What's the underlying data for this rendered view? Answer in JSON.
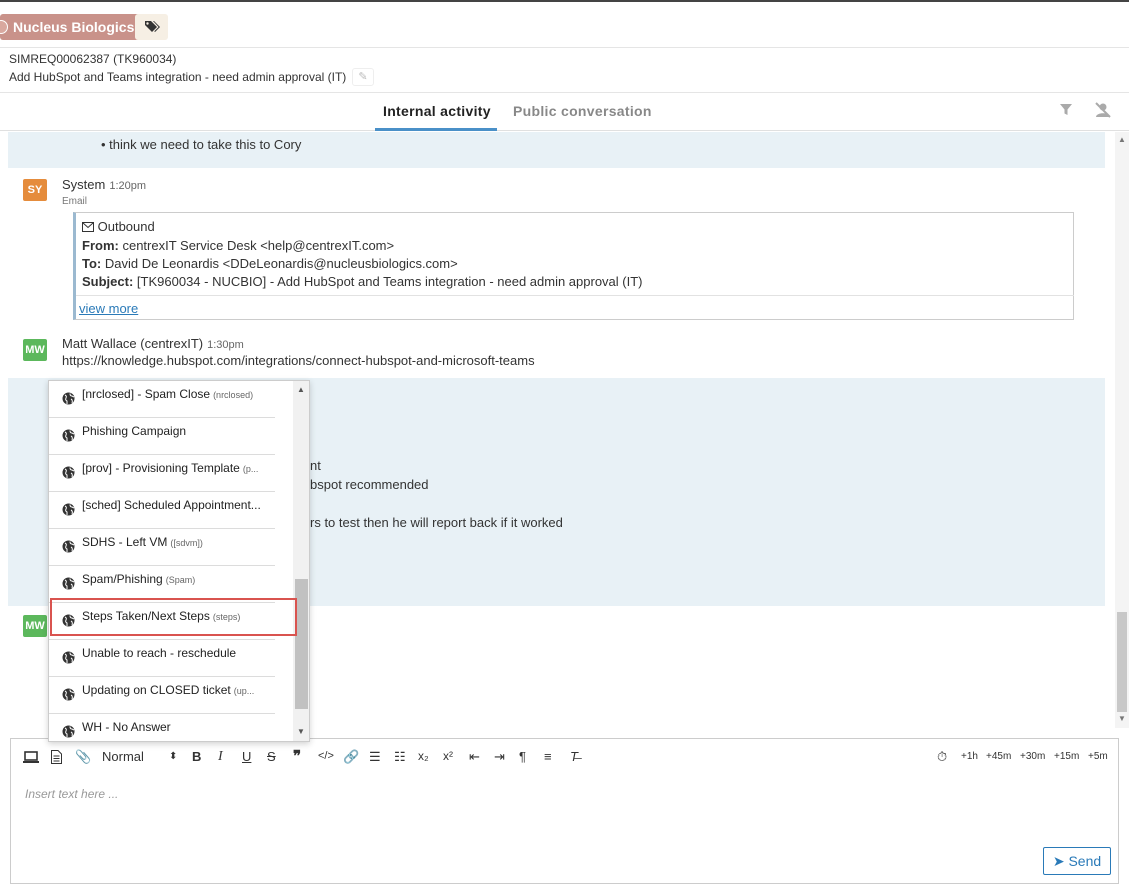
{
  "header": {
    "org_name": "Nucleus Biologics",
    "ticket_id": "SIMREQ00062387 (TK960034)",
    "ticket_title": "Add HubSpot and Teams integration - need admin approval (IT)"
  },
  "tabs": [
    {
      "label": "Internal activity",
      "active": true
    },
    {
      "label": "Public conversation",
      "active": false
    }
  ],
  "feed": {
    "bullet_line": "• think we need to take this to Cory",
    "entries": [
      {
        "initials": "SY",
        "author": "System",
        "time": "1:20pm",
        "sub": "Email",
        "email": {
          "direction": "Outbound",
          "from_label": "From:",
          "from": "centrexIT Service Desk <help@centrexIT.com>",
          "to_label": "To:",
          "to": "David De Leonardis <DDeLeonardis@nucleusbiologics.com>",
          "subject_label": "Subject:",
          "subject": "[TK960034 - NUCBIO] - Add HubSpot and Teams integration - need admin approval (IT)",
          "view_more": "view more"
        }
      },
      {
        "initials": "MW",
        "author": "Matt Wallace (centrexIT)",
        "time": "1:30pm",
        "text": "https://knowledge.hubspot.com/integrations/connect-hubspot-and-microsoft-teams"
      }
    ],
    "partial_lines": [
      "nt",
      "bspot recommended",
      "rs to test then he will report back if it worked"
    ],
    "third_initials": "MW"
  },
  "dropdown": {
    "items": [
      {
        "label": "[nrclosed] - Spam Close",
        "shortcut": "(nrclosed)"
      },
      {
        "label": "Phishing Campaign",
        "shortcut": ""
      },
      {
        "label": "[prov] - Provisioning Template",
        "shortcut": "(p..."
      },
      {
        "label": "[sched] Scheduled Appointment...",
        "shortcut": ""
      },
      {
        "label": "SDHS - Left VM",
        "shortcut": "([sdvm])"
      },
      {
        "label": "Spam/Phishing",
        "shortcut": "(Spam)"
      },
      {
        "label": "Steps Taken/Next Steps",
        "shortcut": "(steps)"
      },
      {
        "label": "Unable to reach - reschedule",
        "shortcut": ""
      },
      {
        "label": "Updating on CLOSED ticket",
        "shortcut": "(up..."
      },
      {
        "label": "WH - No Answer",
        "shortcut": ""
      }
    ],
    "highlighted_index": 6
  },
  "editor": {
    "format_select": "Normal",
    "placeholder": "Insert text here ...",
    "time_buttons": [
      "+1h",
      "+45m",
      "+30m",
      "+15m",
      "+5m"
    ],
    "send_label": "Send"
  },
  "colors": {
    "org_badge": "#c9928a",
    "accent": "#4a90c8",
    "highlight_border": "#d9534f",
    "system_avatar": "#e58c3c",
    "user_avatar": "#5cb85c",
    "band": "#e8f1f6"
  }
}
